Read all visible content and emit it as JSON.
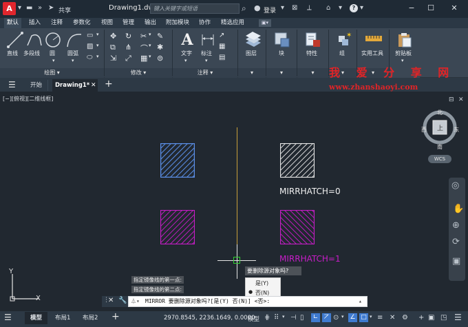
{
  "titlebar": {
    "app_logo": "A",
    "share_label": "共享",
    "doc_title": "Drawing1.dwg",
    "search_placeholder": "键入关键字或短语",
    "signin_label": "登录",
    "help_label": "?"
  },
  "ribbon_tabs": [
    "默认",
    "插入",
    "注释",
    "参数化",
    "视图",
    "管理",
    "输出",
    "附加模块",
    "协作",
    "精选应用"
  ],
  "active_ribbon_tab": "默认",
  "ribbon": {
    "draw_tools": [
      "直线",
      "多段线",
      "圆",
      "圆弧"
    ],
    "draw_panel_label": "绘图",
    "modify_panel_label": "修改",
    "text_label": "文字",
    "dimension_label": "标注",
    "annotation_panel_label": "注释",
    "layers_label": "图层",
    "block_label": "块",
    "properties_label": "特性",
    "group_label": "组",
    "utilities_label": "实用工具",
    "clipboard_label": "剪贴板"
  },
  "watermark": {
    "title": "我 爱 分 享 网",
    "url": "www.zhanshaoyi.com"
  },
  "doc_tabs": {
    "menu_icon": "hamburger-icon",
    "start_tab": "开始",
    "drawing_tab": "Drawing1*",
    "add_tab": "+"
  },
  "viewport": {
    "label": "[−][俯视][二维线框]"
  },
  "viewcube": {
    "north": "北",
    "south": "南",
    "east": "东",
    "west": "西",
    "top_face": "上",
    "wcs": "WCS"
  },
  "canvas_text": {
    "mirrhatch0": "MIRRHATCH=0",
    "mirrhatch1": "MIRRHATCH=1"
  },
  "popup": {
    "title": "要删除源对象吗?",
    "options": [
      "是(Y)",
      "否(N)"
    ],
    "selected_option": "否(N)"
  },
  "command": {
    "history": [
      "指定镜像线的第一点:",
      "指定镜像线的第二点:"
    ],
    "prompt": "MIRROR 要删除源对象吗?[是(Y) 否(N)] <否>:"
  },
  "ucs": {
    "y_label": "Y",
    "x_label": "X"
  },
  "statusbar": {
    "model_tab": "模型",
    "layout1_tab": "布局1",
    "layout2_tab": "布局2",
    "coordinates": "2970.8545, 2236.1649, 0.0000",
    "model_space": "模型"
  },
  "colors": {
    "blue_hatch": "#5b8fe8",
    "white_hatch": "#e8e8e8",
    "magenta_hatch": "#c81dc8",
    "mirror_line": "#c9a13a",
    "watermark": "#e02427"
  }
}
